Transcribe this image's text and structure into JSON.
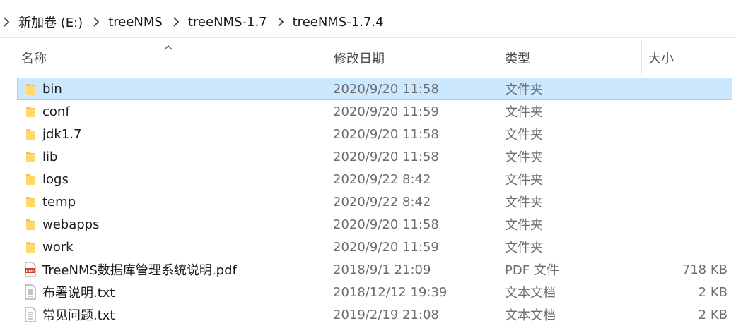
{
  "breadcrumb": {
    "items": [
      "新加卷 (E:)",
      "treeNMS",
      "treeNMS-1.7",
      "treeNMS-1.7.4"
    ]
  },
  "columns": {
    "name": "名称",
    "modified": "修改日期",
    "type": "类型",
    "size": "大小"
  },
  "colors": {
    "selection": "#cce8ff",
    "selection_border": "#99d1ff",
    "folder": "#f2c55c",
    "pdf": "#d63a2f"
  },
  "files": [
    {
      "name": "bin",
      "modified": "2020/9/20 11:58",
      "type": "文件夹",
      "size": "",
      "icon": "folder-icon",
      "selected": true
    },
    {
      "name": "conf",
      "modified": "2020/9/20 11:59",
      "type": "文件夹",
      "size": "",
      "icon": "folder-icon"
    },
    {
      "name": "jdk1.7",
      "modified": "2020/9/20 11:58",
      "type": "文件夹",
      "size": "",
      "icon": "folder-icon"
    },
    {
      "name": "lib",
      "modified": "2020/9/20 11:58",
      "type": "文件夹",
      "size": "",
      "icon": "folder-icon"
    },
    {
      "name": "logs",
      "modified": "2020/9/22 8:42",
      "type": "文件夹",
      "size": "",
      "icon": "folder-icon"
    },
    {
      "name": "temp",
      "modified": "2020/9/22 8:42",
      "type": "文件夹",
      "size": "",
      "icon": "folder-icon"
    },
    {
      "name": "webapps",
      "modified": "2020/9/20 11:58",
      "type": "文件夹",
      "size": "",
      "icon": "folder-icon"
    },
    {
      "name": "work",
      "modified": "2020/9/20 11:59",
      "type": "文件夹",
      "size": "",
      "icon": "folder-icon"
    },
    {
      "name": "TreeNMS数据库管理系统说明.pdf",
      "modified": "2018/9/1 21:09",
      "type": "PDF 文件",
      "size": "718 KB",
      "icon": "pdf-file-icon"
    },
    {
      "name": "布署说明.txt",
      "modified": "2018/12/12 19:39",
      "type": "文本文档",
      "size": "2 KB",
      "icon": "text-file-icon"
    },
    {
      "name": "常见问题.txt",
      "modified": "2019/2/19 21:08",
      "type": "文本文档",
      "size": "2 KB",
      "icon": "text-file-icon"
    }
  ]
}
